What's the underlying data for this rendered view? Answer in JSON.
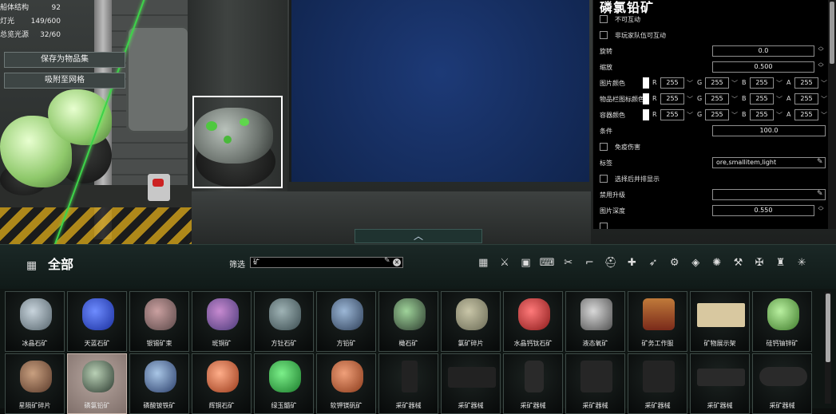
{
  "stats": [
    {
      "label": "船体结构",
      "value": "92"
    },
    {
      "label": "灯光",
      "value": "149/600"
    },
    {
      "label": "总览光源",
      "value": "32/60"
    }
  ],
  "side_buttons": {
    "save": "保存为物品集",
    "snap": "吸附至网格"
  },
  "collapse_icon": "chevron-up-icon",
  "panel": {
    "title": "磷氯铅矿",
    "non_interactable": "不可互动",
    "non_player_team": "非玩家队伍可互动",
    "rotation_label": "旋转",
    "rotation_value": "0.0",
    "scale_label": "缩放",
    "scale_value": "0.500",
    "sprite_color_label": "图片颜色",
    "inventory_icon_color_label": "物品栏图标颜色",
    "container_color_label": "容器颜色",
    "rgba": {
      "r": "R",
      "g": "G",
      "b": "B",
      "a": "A",
      "v": "255"
    },
    "condition_label": "条件",
    "condition_value": "100.0",
    "invulnerable_label": "免疫伤害",
    "tags_label": "标签",
    "tags_value": "ore,smallitem,light",
    "display_side_label": "选择后并排显示",
    "disable_upgrade_label": "禁用升级",
    "disable_upgrade_value": "",
    "sprite_depth_label": "图片深度",
    "sprite_depth_value": "0.550"
  },
  "bar": {
    "category": "全部",
    "filter_label": "筛选",
    "filter_value": "矿",
    "category_icons": [
      "grid-icon",
      "weapon-icon",
      "device-icon",
      "computer-icon",
      "tool-icon",
      "gun-icon",
      "diving-icon",
      "medical-icon",
      "ammo-icon",
      "gear-icon",
      "material-icon",
      "reactor-icon",
      "wrench-icon",
      "engine-icon",
      "suit-icon",
      "misc-icon"
    ]
  },
  "items_row1": [
    "冰晶石矿",
    "天蓝石矿",
    "银锡矿束",
    "斑铜矿",
    "方钍石矿",
    "方铅矿",
    "橄石矿",
    "氯矿碎片",
    "水晶钙钛石矿",
    "液态氧矿",
    "矿务工作服",
    "矿物展示架",
    "硅钙铀锌矿"
  ],
  "items_row2": [
    "星陨矿碎片",
    "磷氯铅矿",
    "磷酸铍铁矿",
    "辉铜石矿",
    "绿玉髓矿",
    "软钾镁矾矿",
    "采矿器械",
    "采矿器械",
    "采矿器械",
    "采矿器械",
    "采矿器械",
    "采矿器械",
    "采矿器械"
  ],
  "colors": {
    "accent": "#3dd24a",
    "bar_bg": "#1b2826",
    "panel_bg": "#000000",
    "selected_tile": "#a8968e"
  }
}
